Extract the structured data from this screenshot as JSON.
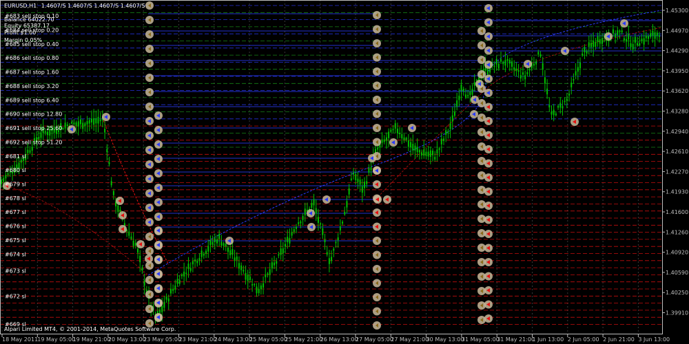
{
  "window": {
    "symbol_timeframe": "EURUSD,H1",
    "ohlc_text": "1.4607/S 1.4607/S 1.4607/S 1.4607/S",
    "copyright": "Alpari Limited MT4, © 2001-2014, MetaQuotes Software Corp."
  },
  "account": {
    "balance": "Balance  64022.70",
    "equity": "Equity  65387.17",
    "profit": "Profit  $1.00",
    "margin": "Margin  0.05%"
  },
  "colors": {
    "background": "#000000",
    "axis": "#bfbfbf",
    "candle": "#00c000",
    "grid": "#3a3a3a",
    "buy_line": "#2b3bff",
    "sell_line": "#e81010",
    "green_level": "#1b9a1b",
    "marker_ring": "#c8b89a",
    "label_text": "#ffffff"
  },
  "chart_data": {
    "type": "candlestick",
    "symbol": "EURUSD",
    "timeframe": "H1",
    "y_ticks": [
      "1.45300",
      "1.44970",
      "1.44290",
      "1.43950",
      "1.43620",
      "1.43280",
      "1.42940",
      "1.42610",
      "1.42270",
      "1.41930",
      "1.41600",
      "1.41260",
      "1.40920",
      "1.40590",
      "1.40250",
      "1.39910"
    ],
    "x_ticks": [
      "18 May 2011",
      "19 May 05:00",
      "19 May 21:00",
      "20 May 13:00",
      "23 May 05:00",
      "23 May 21:00",
      "24 May 13:00",
      "25 May 05:00",
      "25 May 21:00",
      "26 May 13:00",
      "27 May 05:00",
      "27 May 21:00",
      "30 May 13:00",
      "31 May 05:00",
      "31 May 21:00",
      "1 Jun 13:00",
      "2 Jun 05:00",
      "2 Jun 21:00",
      "3 Jun 13:00"
    ],
    "ylim": [
      1.3991,
      1.453
    ],
    "price_path": [
      [
        0,
        1.4224
      ],
      [
        0.03,
        1.426
      ],
      [
        0.06,
        1.431
      ],
      [
        0.1,
        1.4325
      ],
      [
        0.13,
        1.433
      ],
      [
        0.155,
        1.4335
      ],
      [
        0.17,
        1.42
      ],
      [
        0.19,
        1.414
      ],
      [
        0.205,
        1.411
      ],
      [
        0.215,
        1.406
      ],
      [
        0.225,
        1.401
      ],
      [
        0.235,
        1.398
      ],
      [
        0.27,
        1.405
      ],
      [
        0.3,
        1.409
      ],
      [
        0.33,
        1.4125
      ],
      [
        0.36,
        1.408
      ],
      [
        0.39,
        1.403
      ],
      [
        0.42,
        1.4085
      ],
      [
        0.45,
        1.415
      ],
      [
        0.475,
        1.4185
      ],
      [
        0.5,
        1.408
      ],
      [
        0.52,
        1.416
      ],
      [
        0.535,
        1.424
      ],
      [
        0.55,
        1.421
      ],
      [
        0.57,
        1.428
      ],
      [
        0.6,
        1.432
      ],
      [
        0.63,
        1.428
      ],
      [
        0.66,
        1.427
      ],
      [
        0.685,
        1.433
      ],
      [
        0.7,
        1.44
      ],
      [
        0.71,
        1.437
      ],
      [
        0.73,
        1.442
      ],
      [
        0.765,
        1.444
      ],
      [
        0.795,
        1.441
      ],
      [
        0.82,
        1.4455
      ],
      [
        0.835,
        1.434
      ],
      [
        0.86,
        1.437
      ],
      [
        0.885,
        1.4455
      ],
      [
        0.91,
        1.448
      ],
      [
        0.94,
        1.449
      ],
      [
        0.96,
        1.447
      ],
      [
        1.0,
        1.449
      ]
    ],
    "level_labels": [
      {
        "label": "#683 sell stop 0.10",
        "price": 1.452
      },
      {
        "label": "#684 sell stop 0.20",
        "price": 1.4495
      },
      {
        "label": "#685 sell stop 0.40",
        "price": 1.447
      },
      {
        "label": "#686 sell stop 0.80",
        "price": 1.4445
      },
      {
        "label": "#687 sell stop 1.60",
        "price": 1.442
      },
      {
        "label": "#688 sell stop 3.20",
        "price": 1.4395
      },
      {
        "label": "#689 sell stop 6.40",
        "price": 1.437
      },
      {
        "label": "#690 sell stop 12.80",
        "price": 1.4345
      },
      {
        "label": "#691 sell stop 25.60",
        "price": 1.432
      },
      {
        "label": "#692 sell stop 51.20",
        "price": 1.4295
      },
      {
        "label": "#681 sl",
        "price": 1.427
      },
      {
        "label": "#680 sl",
        "price": 1.4245
      },
      {
        "label": "#679 sl",
        "price": 1.422
      },
      {
        "label": "#678 sl",
        "price": 1.4195
      },
      {
        "label": "#677 sl",
        "price": 1.417
      },
      {
        "label": "#676 sl",
        "price": 1.4145
      },
      {
        "label": "#675 sl",
        "price": 1.412
      },
      {
        "label": "#674 sl",
        "price": 1.4095
      },
      {
        "label": "#673 sl",
        "price": 1.4065
      },
      {
        "label": "#672 sl",
        "price": 1.402
      },
      {
        "label": "#669 sl",
        "price": 1.397
      }
    ]
  }
}
